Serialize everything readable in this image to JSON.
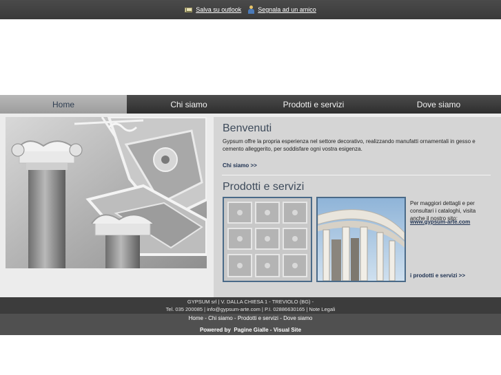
{
  "topbar": {
    "outlook_label": "Salva su outlook",
    "signal_label": "Segnala ad un amico"
  },
  "nav": {
    "items": [
      "Home",
      "Chi siamo",
      "Prodotti e servizi",
      "Dove siamo"
    ],
    "active": "Home"
  },
  "welcome": {
    "title": "Benvenuti",
    "text": "Gypsum offre la propria esperienza nel settore decorativo, realizzando manufatti ornamentali in gesso e cemento alleggerito, per soddisfare ogni vostra esigenza.",
    "link": "Chi siamo >>"
  },
  "products": {
    "title": "Prodotti e servizi",
    "text": "Per maggiori dettagli e per consultari i cataloghi, visita anche il nostro sito:",
    "site": "www.gypsum-arte.com",
    "link": "i prodotti e servizi >>"
  },
  "footer": {
    "company": "GYPSUM srl | V. DALLA CHIESA 1 - TREVIOLO (BG) -",
    "tel": "Tel. 035 200085",
    "email": "info@gypsum-arte.com",
    "piva": "P.I. 02886630165",
    "legal": "Note Legali",
    "sep": "|",
    "dash": "-",
    "links": [
      "Home",
      "Chi siamo",
      "Prodotti e servizi",
      "Dove siamo"
    ],
    "powered_prefix": "Powered by",
    "powered_pg": "Pagine Gialle",
    "powered_vs": "Visual Site"
  },
  "colors": {
    "nav_bg": "#3a3a3a",
    "nav_active": "#aaaaaa",
    "title_text": "#3d4a5a",
    "link_text": "#1d3050",
    "thumb_border": "#4a6a88"
  }
}
